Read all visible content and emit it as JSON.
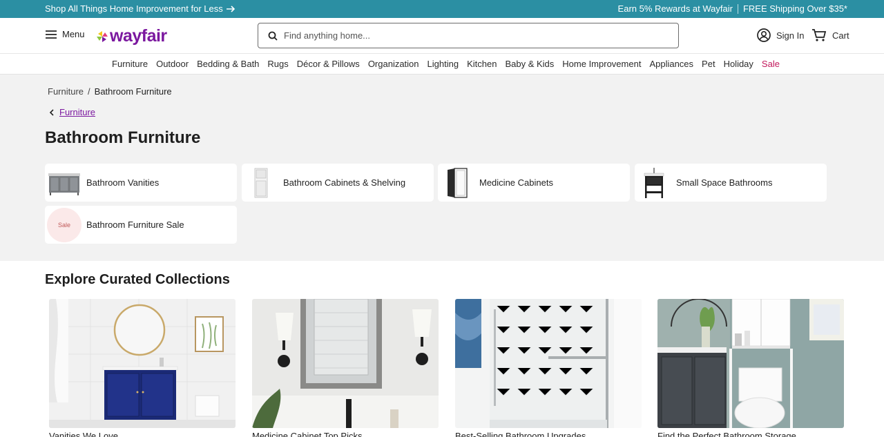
{
  "promo": {
    "left_text": "Shop All Things Home Improvement for Less",
    "rewards_text": "Earn 5% Rewards at Wayfair",
    "shipping_text": "FREE Shipping Over $35*"
  },
  "header": {
    "menu_label": "Menu",
    "logo_text": "wayfair",
    "search_placeholder": "Find anything home...",
    "signin_label": "Sign In",
    "cart_label": "Cart"
  },
  "nav": {
    "items": [
      "Furniture",
      "Outdoor",
      "Bedding & Bath",
      "Rugs",
      "Décor & Pillows",
      "Organization",
      "Lighting",
      "Kitchen",
      "Baby & Kids",
      "Home Improvement",
      "Appliances",
      "Pet",
      "Holiday",
      "Sale"
    ]
  },
  "breadcrumb": {
    "root": "Furniture",
    "separator": "/",
    "current": "Bathroom Furniture",
    "back_label": "Furniture"
  },
  "page_title": "Bathroom Furniture",
  "categories": [
    {
      "label": "Bathroom Vanities",
      "icon": "vanity-thumbnail"
    },
    {
      "label": "Bathroom Cabinets & Shelving",
      "icon": "cabinet-thumbnail"
    },
    {
      "label": "Medicine Cabinets",
      "icon": "medicine-cabinet-thumbnail"
    },
    {
      "label": "Small Space Bathrooms",
      "icon": "small-vanity-thumbnail"
    },
    {
      "label": "Bathroom Furniture Sale",
      "icon": "sale-badge",
      "badge_text": "Sale"
    }
  ],
  "collections": {
    "title": "Explore Curated Collections",
    "cards": [
      {
        "label": "Vanities We Love",
        "image": "navy-vanity-photo"
      },
      {
        "label": "Medicine Cabinet Top Picks",
        "image": "medicine-cabinet-photo"
      },
      {
        "label": "Best-Selling Bathroom Upgrades",
        "image": "glass-shower-photo"
      },
      {
        "label": "Find the Perfect Bathroom Storage",
        "image": "storage-photo"
      }
    ]
  },
  "colors": {
    "promo_bg": "#2b8fa3",
    "brand_purple": "#7b189f",
    "sale_red": "#c2185b",
    "band_bg": "#f2f2f2"
  }
}
